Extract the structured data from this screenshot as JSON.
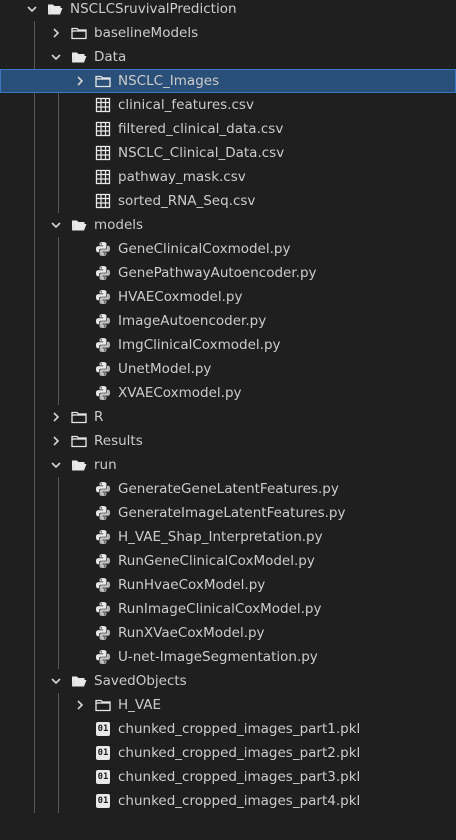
{
  "explorer": {
    "items": [
      {
        "depth": 0,
        "type": "folder",
        "expanded": true,
        "label": "NSCLCSruvivalPrediction"
      },
      {
        "depth": 1,
        "type": "folder",
        "expanded": false,
        "label": "baselineModels"
      },
      {
        "depth": 1,
        "type": "folder",
        "expanded": true,
        "label": "Data"
      },
      {
        "depth": 2,
        "type": "folder",
        "expanded": false,
        "label": "NSCLC_Images",
        "selected": true
      },
      {
        "depth": 2,
        "type": "csv",
        "label": "clinical_features.csv"
      },
      {
        "depth": 2,
        "type": "csv",
        "label": "filtered_clinical_data.csv"
      },
      {
        "depth": 2,
        "type": "csv",
        "label": "NSCLC_Clinical_Data.csv"
      },
      {
        "depth": 2,
        "type": "csv",
        "label": "pathway_mask.csv"
      },
      {
        "depth": 2,
        "type": "csv",
        "label": "sorted_RNA_Seq.csv"
      },
      {
        "depth": 1,
        "type": "folder",
        "expanded": true,
        "label": "models"
      },
      {
        "depth": 2,
        "type": "py",
        "label": "GeneClinicalCoxmodel.py"
      },
      {
        "depth": 2,
        "type": "py",
        "label": "GenePathwayAutoencoder.py"
      },
      {
        "depth": 2,
        "type": "py",
        "label": "HVAECoxmodel.py"
      },
      {
        "depth": 2,
        "type": "py",
        "label": "ImageAutoencoder.py"
      },
      {
        "depth": 2,
        "type": "py",
        "label": "ImgClinicalCoxmodel.py"
      },
      {
        "depth": 2,
        "type": "py",
        "label": "UnetModel.py"
      },
      {
        "depth": 2,
        "type": "py",
        "label": "XVAECoxmodel.py"
      },
      {
        "depth": 1,
        "type": "folder",
        "expanded": false,
        "label": "R"
      },
      {
        "depth": 1,
        "type": "folder",
        "expanded": false,
        "label": "Results"
      },
      {
        "depth": 1,
        "type": "folder",
        "expanded": true,
        "label": "run"
      },
      {
        "depth": 2,
        "type": "py",
        "label": "GenerateGeneLatentFeatures.py"
      },
      {
        "depth": 2,
        "type": "py",
        "label": "GenerateImageLatentFeatures.py"
      },
      {
        "depth": 2,
        "type": "py",
        "label": "H_VAE_Shap_Interpretation.py"
      },
      {
        "depth": 2,
        "type": "py",
        "label": "RunGeneClinicalCoxModel.py"
      },
      {
        "depth": 2,
        "type": "py",
        "label": "RunHvaeCoxModel.py"
      },
      {
        "depth": 2,
        "type": "py",
        "label": "RunImageClinicalCoxModel.py"
      },
      {
        "depth": 2,
        "type": "py",
        "label": "RunXVaeCoxModel.py"
      },
      {
        "depth": 2,
        "type": "py",
        "label": "U-net-ImageSegmentation.py"
      },
      {
        "depth": 1,
        "type": "folder",
        "expanded": true,
        "label": "SavedObjects"
      },
      {
        "depth": 2,
        "type": "folder",
        "expanded": false,
        "label": "H_VAE"
      },
      {
        "depth": 2,
        "type": "pkl",
        "label": "chunked_cropped_images_part1.pkl"
      },
      {
        "depth": 2,
        "type": "pkl",
        "label": "chunked_cropped_images_part2.pkl"
      },
      {
        "depth": 2,
        "type": "pkl",
        "label": "chunked_cropped_images_part3.pkl"
      },
      {
        "depth": 2,
        "type": "pkl",
        "label": "chunked_cropped_images_part4.pkl"
      }
    ]
  },
  "colors": {
    "background": "#1f1f1f",
    "text": "#cccccc",
    "selected_bg": "#2a4f78",
    "selected_border": "#3b78c4",
    "icon": "#e8e8e8",
    "guide": "#585858"
  },
  "icons": {
    "folder": "folder-icon",
    "folder_open": "folder-open-icon",
    "csv": "table-icon",
    "py": "python-icon",
    "pkl": "binary-file-icon",
    "chevron_right": "chevron-right-icon",
    "chevron_down": "chevron-down-icon"
  },
  "pkl_glyph": "01"
}
